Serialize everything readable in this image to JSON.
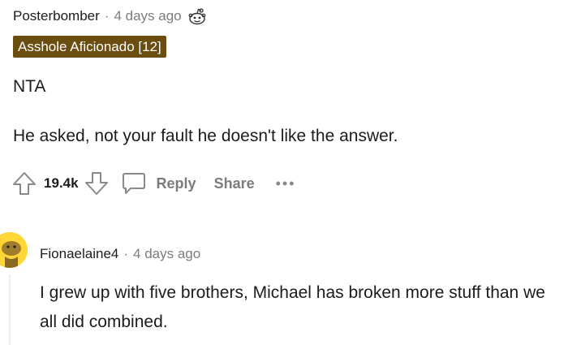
{
  "comment": {
    "username": "Posterbomber",
    "separator": "·",
    "timestamp": "4 days ago",
    "flair": "Asshole Aficionado [12]",
    "verdict": "NTA",
    "text": "He asked, not your fault he doesn't like the answer.",
    "actions": {
      "vote_count": "19.4k",
      "reply_label": "Reply",
      "share_label": "Share",
      "more_label": "•••"
    },
    "icons": {
      "award": "reddit-snoo-award-icon",
      "upvote": "upvote-arrow-icon",
      "downvote": "downvote-arrow-icon",
      "reply": "speech-bubble-icon",
      "more": "more-options-icon"
    }
  },
  "reply": {
    "username": "Fionaelaine4",
    "separator": "·",
    "timestamp": "4 days ago",
    "text": "I grew up with five brothers, Michael has broken more stuff than we all did combined.",
    "avatar": "snoo-avatar-icon",
    "avatar_color": "#ffd635"
  },
  "colors": {
    "flair_bg": "#6b4e0f",
    "meta_text": "#7c7c7c",
    "body_text": "#1c1c1c",
    "action_text": "#7c7c7c"
  }
}
